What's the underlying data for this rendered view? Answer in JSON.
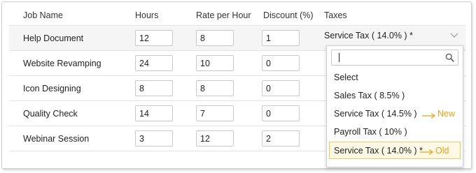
{
  "headers": {
    "job_name": "Job Name",
    "hours": "Hours",
    "rate": "Rate per Hour",
    "discount": "Discount (%)",
    "taxes": "Taxes"
  },
  "rows": [
    {
      "job": "Help Document",
      "hours": "12",
      "rate": "8",
      "discount": "1"
    },
    {
      "job": "Website Revamping",
      "hours": "24",
      "rate": "10",
      "discount": "0"
    },
    {
      "job": "Icon Designing",
      "hours": "8",
      "rate": "8",
      "discount": "0"
    },
    {
      "job": "Quality Check",
      "hours": "14",
      "rate": "7",
      "discount": "0"
    },
    {
      "job": "Webinar Session",
      "hours": "3",
      "rate": "12",
      "discount": "2"
    }
  ],
  "tax_select": {
    "selected_value": "Service Tax ( 14.0% ) *"
  },
  "dropdown": {
    "search_value": "",
    "options": [
      "Select",
      "Sales Tax ( 8.5% )",
      "Service Tax ( 14.5% )",
      "Payroll Tax ( 10% )",
      "Service Tax ( 14.0% ) *"
    ],
    "annotation_new": "New",
    "annotation_old": "Old"
  },
  "colors": {
    "accent": "#e6a319",
    "highlight_bg": "#fff8e6",
    "highlight_border": "#f0c85a",
    "row_highlight": "#f5f5f5"
  }
}
